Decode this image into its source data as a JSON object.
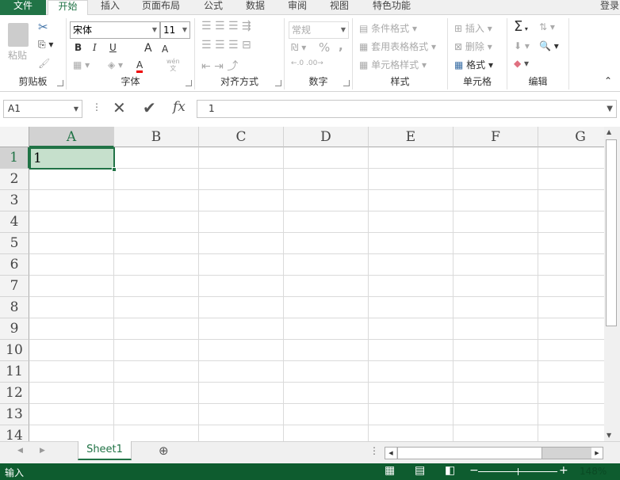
{
  "tabs": {
    "file": "文件",
    "items": [
      "开始",
      "插入",
      "页面布局",
      "公式",
      "数据",
      "审阅",
      "视图",
      "特色功能"
    ],
    "login": "登录"
  },
  "ribbon": {
    "clipboard": {
      "label": "剪贴板",
      "paste": "粘贴"
    },
    "font": {
      "label": "字体",
      "font_name": "宋体",
      "font_size": "11",
      "bold": "B",
      "italic": "I",
      "underline": "U",
      "grow": "A",
      "shrink": "A",
      "font_color": "A",
      "phonetic_top": "wén",
      "phonetic_bottom": "文"
    },
    "align": {
      "label": "对齐方式"
    },
    "number": {
      "label": "数字",
      "format": "常规",
      "percent": "%",
      "comma": ","
    },
    "styles": {
      "label": "样式",
      "conditional": "条件格式",
      "table": "套用表格格式",
      "cell_styles": "单元格样式"
    },
    "cells": {
      "label": "单元格",
      "insert": "插入",
      "delete": "删除",
      "format": "格式"
    },
    "editing": {
      "label": "编辑",
      "sum": "Σ"
    }
  },
  "formula_bar": {
    "name_box": "A1",
    "fx": "fx",
    "value": "1"
  },
  "grid": {
    "columns": [
      "A",
      "B",
      "C",
      "D",
      "E",
      "F",
      "G"
    ],
    "rows": [
      "1",
      "2",
      "3",
      "4",
      "5",
      "6",
      "7",
      "8",
      "9",
      "10",
      "11",
      "12",
      "13",
      "14"
    ],
    "selected": "A1",
    "cells": {
      "A1": "1"
    }
  },
  "sheets": {
    "tabs": [
      "Sheet1"
    ],
    "active": "Sheet1"
  },
  "status": {
    "mode": "输入",
    "zoom": "148%"
  },
  "colors": {
    "accent": "#217346",
    "status_bg": "#0e5c2f",
    "selection_fill": "#c6e0cc"
  }
}
